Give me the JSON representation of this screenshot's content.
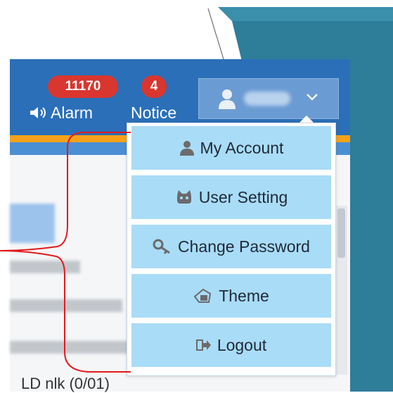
{
  "header": {
    "alarm_count": "11170",
    "alarm_label": "Alarm",
    "notice_count": "4",
    "notice_label": "Notice"
  },
  "user_menu": {
    "items": [
      {
        "label": "My Account",
        "icon": "user-icon"
      },
      {
        "label": "User Setting",
        "icon": "user-setting-icon"
      },
      {
        "label": "Change Password",
        "icon": "key-icon"
      },
      {
        "label": "Theme",
        "icon": "theme-icon"
      },
      {
        "label": "Logout",
        "icon": "logout-icon"
      }
    ]
  },
  "content": {
    "bottom_text": "LD nlk (0/01)"
  },
  "colors": {
    "header_blue": "#2a6fb8",
    "orange_strip": "#f5a11a",
    "badge_red": "#d9362f",
    "menu_item_bg": "#a9dcf7",
    "annotation_red": "#e01b1b"
  }
}
